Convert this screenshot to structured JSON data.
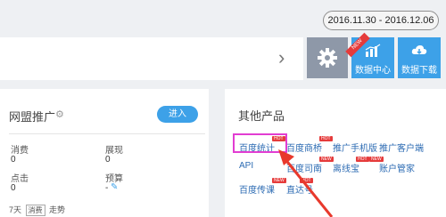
{
  "header": {
    "date_range": "2016.11.30 - 2016.12.06",
    "chevron": "›",
    "buttons": [
      {
        "label": "数据中心",
        "badge": "NEW"
      },
      {
        "label": "数据下载"
      }
    ]
  },
  "wanglian_card": {
    "title": "网盟推广",
    "enter_label": "进入",
    "stats": [
      {
        "label": "消费",
        "value": "0"
      },
      {
        "label": "展现",
        "value": "0"
      },
      {
        "label": "点击",
        "value": "0"
      },
      {
        "label": "预算",
        "value": "-"
      }
    ],
    "footer": {
      "prefix": "7天",
      "select": "消费",
      "suffix": "走势"
    }
  },
  "other_products": {
    "title": "其他产品",
    "items": [
      {
        "label": "百度统计",
        "badge": "HOT"
      },
      {
        "label": "百度商桥",
        "badge": "HOT"
      },
      {
        "label": "推广手机版"
      },
      {
        "label": "推广客户端"
      },
      {
        "label": "API"
      },
      {
        "label": "百度司南",
        "badge": "NEW"
      },
      {
        "label": "离线宝",
        "badge": "HOT"
      },
      {
        "label": "账户管家",
        "badge": "NEW"
      },
      {
        "label": "百度传课",
        "badge": "NEW"
      },
      {
        "label": "直达号",
        "badge": "HOT"
      }
    ]
  },
  "colors": {
    "accent": "#3da1e8",
    "highlight": "#e23dd2",
    "arrow": "#e8392c",
    "badge": "#e53b3b"
  }
}
